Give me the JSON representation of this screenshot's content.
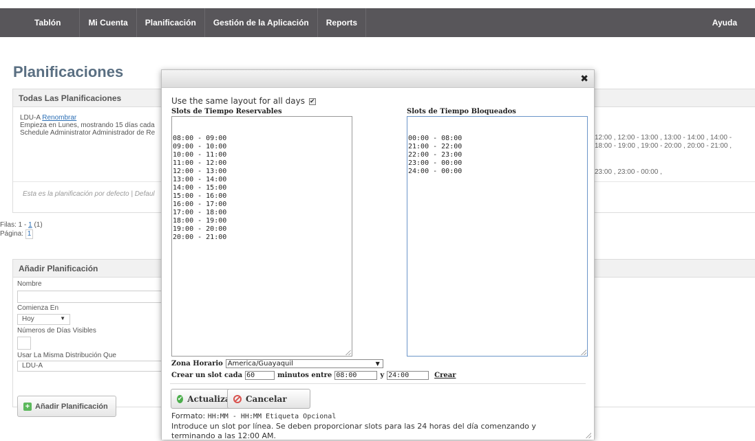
{
  "nav": {
    "items": [
      "Tablón",
      "Mi Cuenta",
      "Planificación",
      "Gestión de la Aplicación",
      "Reports"
    ],
    "help": "Ayuda"
  },
  "page": {
    "title": "Planificaciones",
    "all_panel": {
      "title": "Todas Las Planificaciones",
      "schedule_name": "LDU-A",
      "rename_link": "Renombrar",
      "line2": "Empieza en Lunes, mostrando 15 días cada",
      "line3": "Schedule Administrator Administrador de Re",
      "right_line1": "12:00 , 12:00 - 13:00 , 13:00 - 14:00 , 14:00 -",
      "right_line2": "18:00 - 19:00 , 19:00 - 20:00 , 20:00 - 21:00 ,",
      "right_line3": "23:00 , 23:00 - 00:00 ,",
      "footer": "Esta es la planificación por defecto | Defaul"
    },
    "pager": {
      "rows_prefix": "Filas: 1 - ",
      "rows_link": "1",
      "rows_suffix": " (1)",
      "page_label": "Página: ",
      "page_value": "1"
    },
    "add_panel": {
      "title": "Añadir Planificación",
      "name_label": "Nombre",
      "starts_label": "Comienza En",
      "starts_value": "Hoy",
      "days_label": "Números de Días Visibles",
      "layout_label": "Usar La Misma Distribución Que",
      "layout_value": "LDU-A",
      "button": "Añadir Planificación"
    }
  },
  "modal": {
    "same_layout_label": "Use the same layout for all days",
    "same_layout_checked": "✔",
    "reservable_title": "Slots de Tiempo Reservables",
    "reservable_slots": "08:00 - 09:00\n09:00 - 10:00\n10:00 - 11:00\n11:00 - 12:00\n12:00 - 13:00\n13:00 - 14:00\n14:00 - 15:00\n15:00 - 16:00\n16:00 - 17:00\n17:00 - 18:00\n18:00 - 19:00\n19:00 - 20:00\n20:00 - 21:00",
    "blocked_title": "Slots de Tiempo Bloqueados",
    "blocked_slots": "00:00 - 08:00\n21:00 - 22:00\n22:00 - 23:00\n23:00 - 00:00\n24:00 - 00:00",
    "timezone_label": "Zona Horario",
    "timezone_value": "America/Guayaquil",
    "create_prefix": "Crear un slot cada",
    "create_every": "60",
    "create_minutes_between": "minutos entre",
    "create_from": "08:00",
    "create_and": "y",
    "create_to": "24:00",
    "create_link": "Crear",
    "update_button": "Actualizar",
    "cancel_button": "Cancelar",
    "format_label": "Formato: ",
    "format_value": "HH:MM - HH:MM Etiqueta Opcional",
    "help_line1": "Introduce un slot por línea. Se deben proporcionar slots para las 24 horas del día comenzando y",
    "help_line2": "terminando a las 12:00 AM."
  }
}
